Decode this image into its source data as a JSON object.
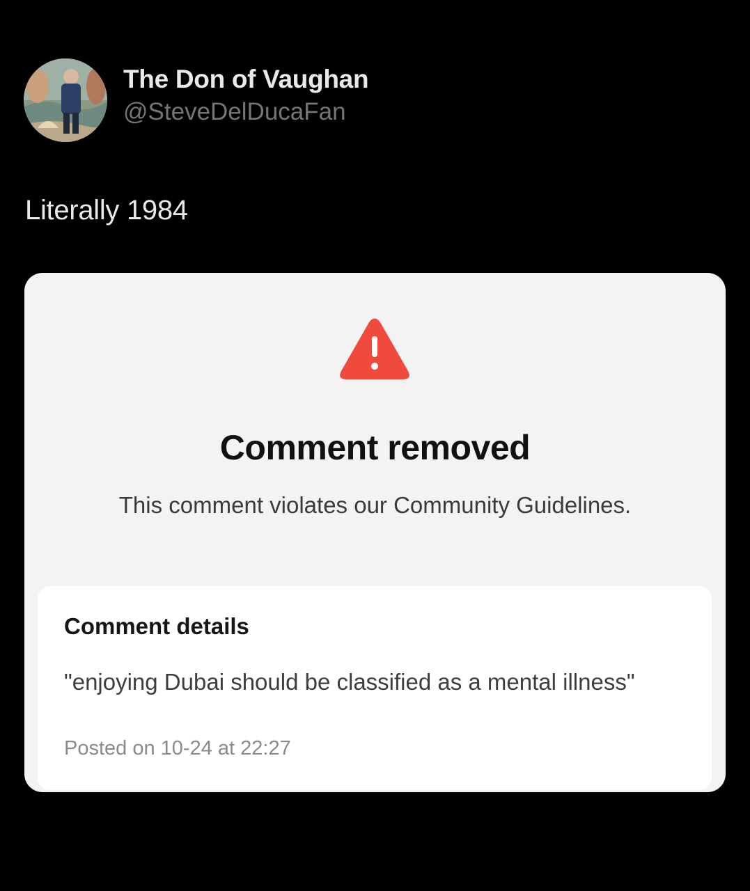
{
  "tweet": {
    "author": {
      "display_name": "The Don of Vaughan",
      "handle": "@SteveDelDucaFan",
      "avatar_icon": "profile-photo-avatar"
    },
    "text": "Literally 1984"
  },
  "embedded_screenshot": {
    "icon": "warning-triangle-icon",
    "icon_color": "#ef4a3c",
    "title": "Comment removed",
    "subtitle": "This comment violates our Community Guidelines.",
    "details": {
      "heading": "Comment details",
      "comment_text": "\"enjoying Dubai should be classified as a mental illness\"",
      "posted": "Posted on 10-24 at 22:27"
    }
  },
  "colors": {
    "background": "#000000",
    "card_background": "#f3f3f3",
    "details_background": "#ffffff",
    "handle_gray": "#71767b"
  }
}
